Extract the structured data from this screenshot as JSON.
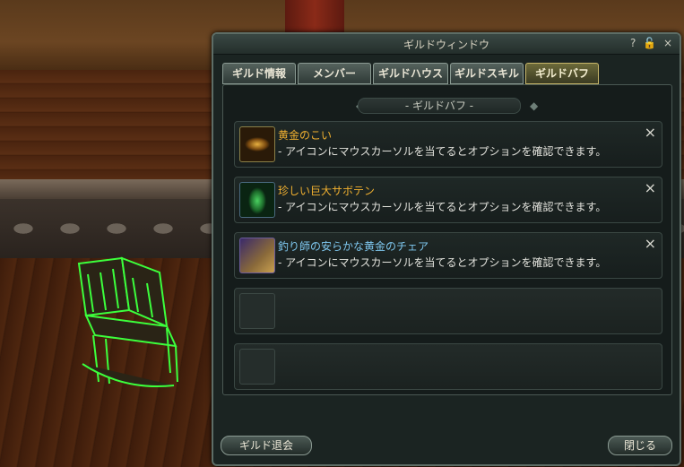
{
  "window": {
    "title": "ギルドウィンドウ",
    "help_icon": "?",
    "lock_icon": "🔓",
    "close_icon": "×"
  },
  "tabs": [
    {
      "label": "ギルド情報"
    },
    {
      "label": "メンバー"
    },
    {
      "label": "ギルドハウス"
    },
    {
      "label": "ギルドスキル"
    },
    {
      "label": "ギルドバフ",
      "active": true
    }
  ],
  "section": {
    "header": "- ギルドバフ -"
  },
  "buffs": [
    {
      "name": "黄金のこい",
      "name_color": "#f0b030",
      "desc": "- アイコンにマウスカーソルを当てるとオプションを確認できます。",
      "icon": "golden-carp-icon",
      "remove": "×"
    },
    {
      "name": "珍しい巨大サボテン",
      "name_color": "#f0b030",
      "desc": "- アイコンにマウスカーソルを当てるとオプションを確認できます。",
      "icon": "giant-cactus-icon",
      "remove": "×"
    },
    {
      "name": "釣り師の安らかな黄金のチェア",
      "name_color": "#7fc8f0",
      "desc": "- アイコンにマウスカーソルを当てるとオプションを確認できます。",
      "icon": "golden-chair-icon",
      "remove": "×"
    }
  ],
  "buttons": {
    "leave_guild": "ギルド退会",
    "close": "閉じる"
  }
}
